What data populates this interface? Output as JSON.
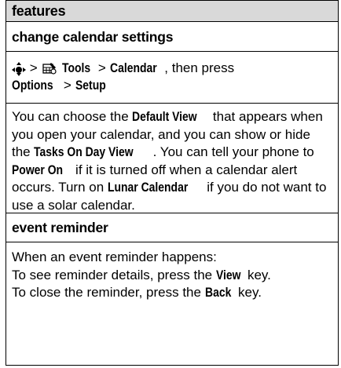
{
  "header": {
    "title": "features"
  },
  "section1": {
    "title": "change calendar settings",
    "nav": {
      "sep1": ">",
      "tools": "Tools",
      "sep2": ">",
      "calendar": "Calendar",
      "then": ", then press",
      "options": "Options",
      "sep3": ">",
      "setup": "Setup"
    },
    "body": {
      "t1": "You can choose the ",
      "k1": "Default View",
      "t2": " that appears when you open your calendar, and you can show or hide the ",
      "k2": "Tasks On Day View",
      "t3": ". You can tell your phone to ",
      "k3": "Power On",
      "t4": " if it is turned off when a calendar alert occurs. Turn on ",
      "k4": "Lunar Calendar",
      "t5": " if you do not want to use a solar calendar."
    }
  },
  "section2": {
    "title": "event reminder",
    "line1": "When an event reminder happens:",
    "line2a": "To see reminder details, press the ",
    "line2k": "View",
    "line2b": " key.",
    "line3a": "To close the reminder, press the ",
    "line3k": "Back",
    "line3b": " key."
  },
  "icons": {
    "nav": "nav-key-icon",
    "tools": "tools-icon"
  }
}
